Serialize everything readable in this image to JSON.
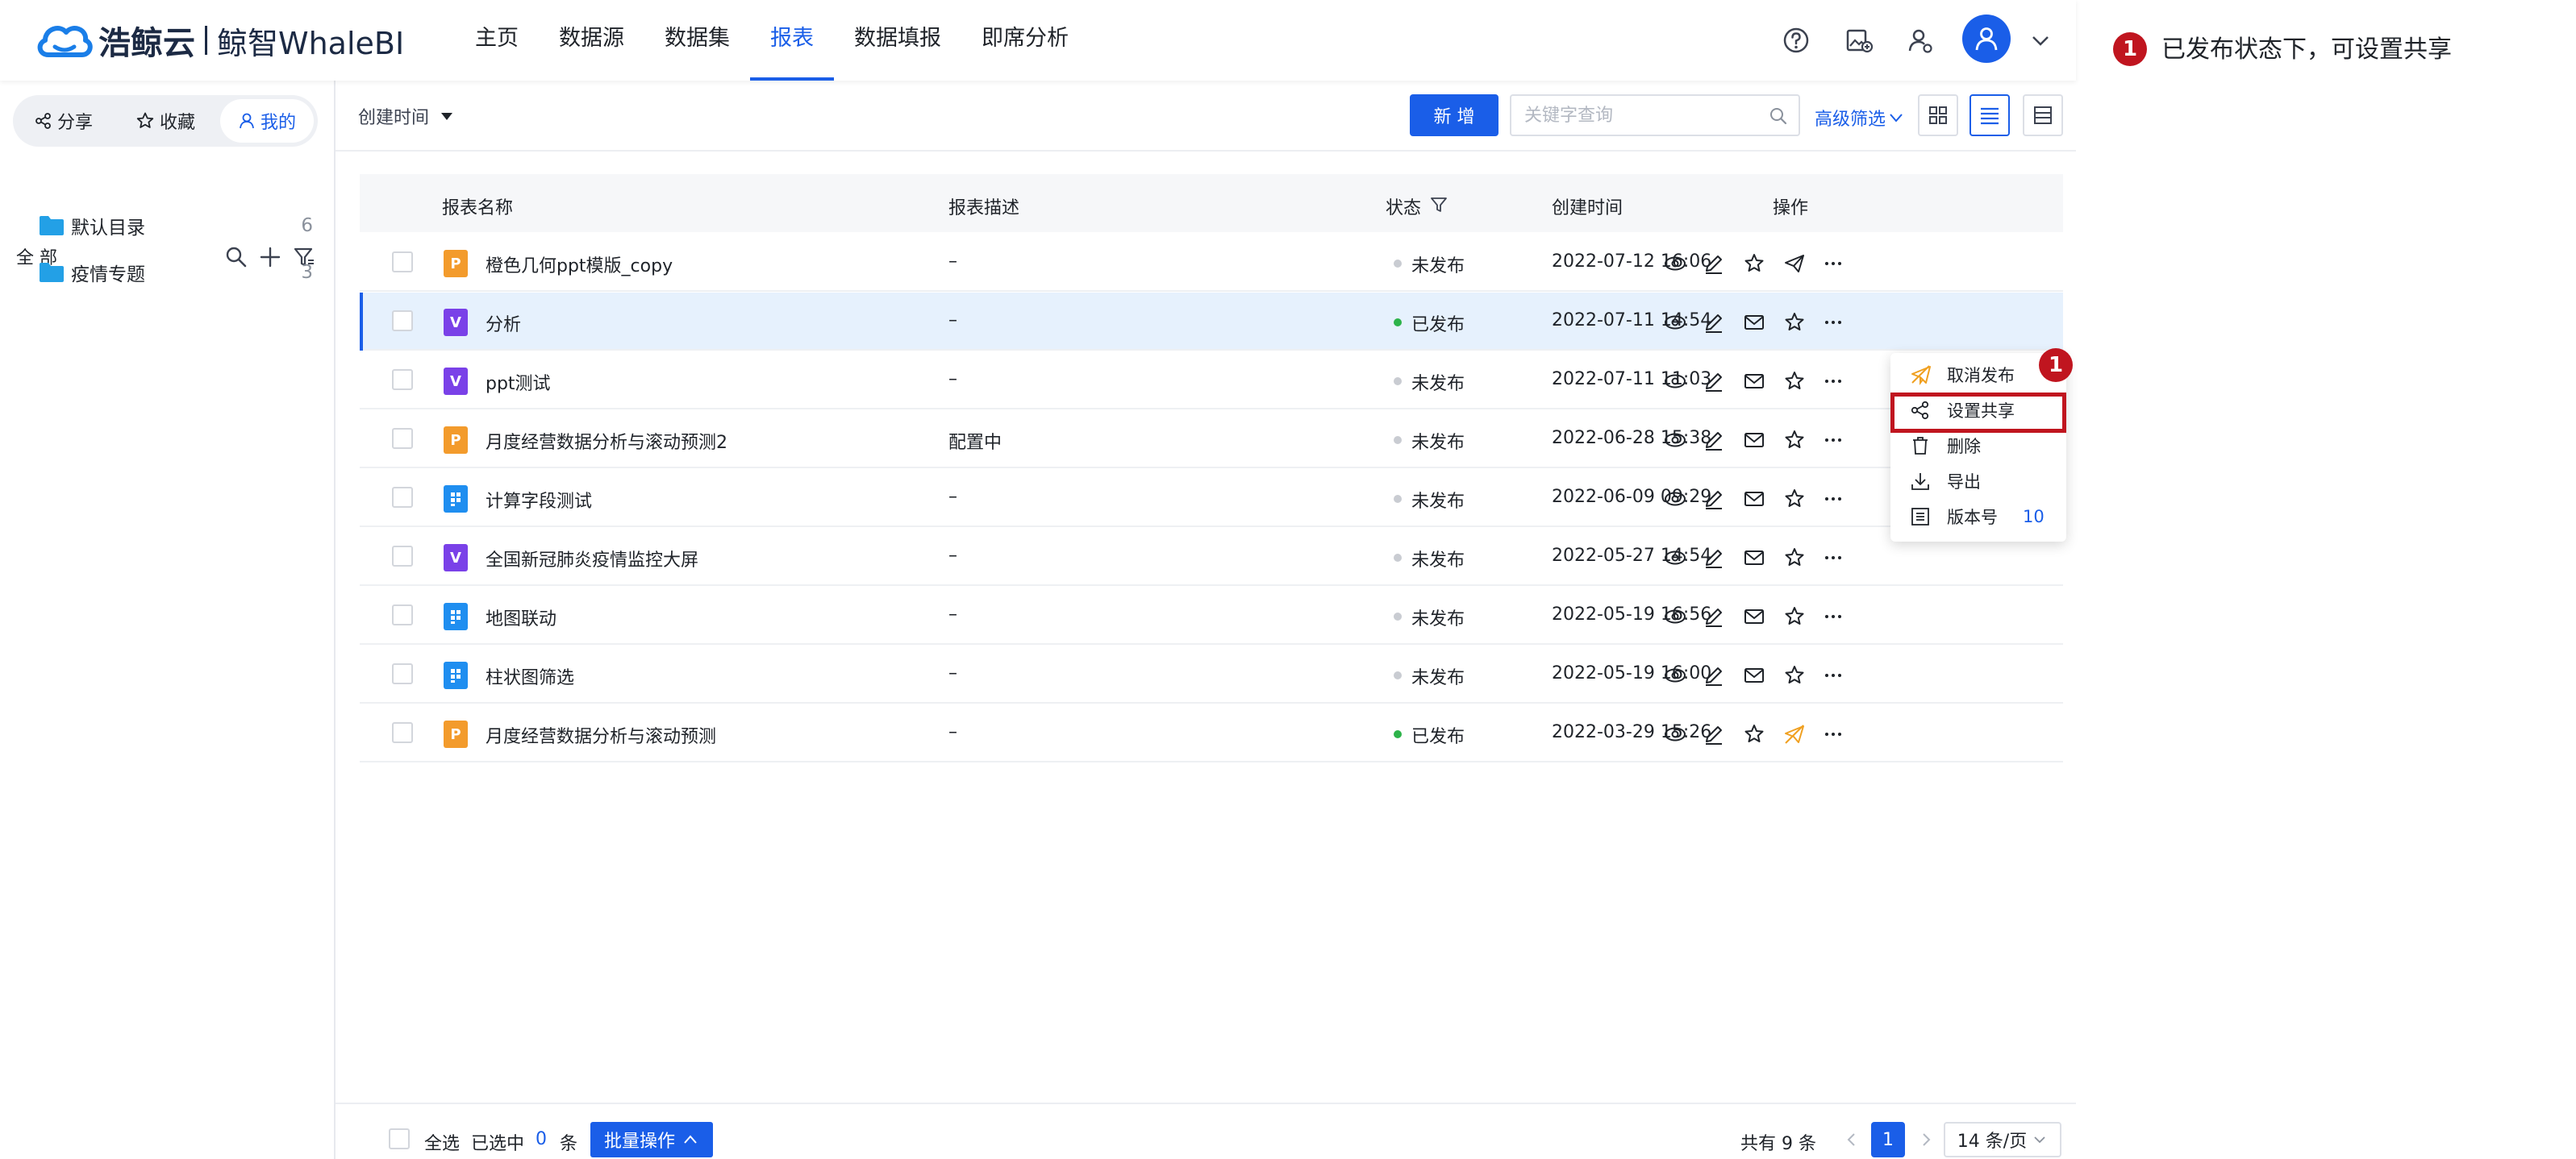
{
  "header": {
    "brand": "浩鲸云",
    "product": "鲸智WhaleBI",
    "nav": [
      "主页",
      "数据源",
      "数据集",
      "报表",
      "数据填报",
      "即席分析"
    ],
    "active_nav_index": 3,
    "icons": [
      "help-icon",
      "image-manage-icon",
      "user-manage-icon",
      "user-avatar-icon",
      "chevron-down-icon"
    ]
  },
  "sidebar": {
    "tabs": [
      "分享",
      "收藏",
      "我的"
    ],
    "active_tab_index": 2,
    "tree_root": "全 部",
    "folders": [
      {
        "name": "默认目录",
        "count": "6"
      },
      {
        "name": "疫情专题",
        "count": "3"
      }
    ]
  },
  "toolbar": {
    "sort_label": "创建时间",
    "add_label": "新 增",
    "search_placeholder": "关键字查询",
    "search_value": "",
    "advanced_filter": "高级筛选"
  },
  "table": {
    "columns": [
      "报表名称",
      "报表描述",
      "状态",
      "创建时间",
      "操作"
    ],
    "rows": [
      {
        "icon": "P",
        "name": "橙色几何ppt模版_copy",
        "desc": "–",
        "status": "未发布",
        "published": false,
        "time": "2022-07-12 16:06"
      },
      {
        "icon": "V",
        "name": "分析",
        "desc": "–",
        "status": "已发布",
        "published": true,
        "time": "2022-07-11 14:54",
        "selected": true
      },
      {
        "icon": "V",
        "name": "ppt测试",
        "desc": "–",
        "status": "未发布",
        "published": false,
        "time": "2022-07-11 11:03"
      },
      {
        "icon": "P",
        "name": "月度经营数据分析与滚动预测2",
        "desc": "配置中",
        "status": "未发布",
        "published": false,
        "time": "2022-06-28 15:38"
      },
      {
        "icon": "T",
        "name": "计算字段测试",
        "desc": "–",
        "status": "未发布",
        "published": false,
        "time": "2022-06-09 09:29"
      },
      {
        "icon": "V",
        "name": "全国新冠肺炎疫情监控大屏",
        "desc": "–",
        "status": "未发布",
        "published": false,
        "time": "2022-05-27 14:54"
      },
      {
        "icon": "T",
        "name": "地图联动",
        "desc": "–",
        "status": "未发布",
        "published": false,
        "time": "2022-05-19 16:56"
      },
      {
        "icon": "T",
        "name": "柱状图筛选",
        "desc": "–",
        "status": "未发布",
        "published": false,
        "time": "2022-05-19 16:00"
      },
      {
        "icon": "P",
        "name": "月度经营数据分析与滚动预测",
        "desc": "–",
        "status": "已发布",
        "published": true,
        "time": "2022-03-29 15:26"
      }
    ]
  },
  "menu": {
    "items": [
      "取消发布",
      "设置共享",
      "删除",
      "导出",
      "版本号"
    ],
    "version": "10",
    "highlighted_index": 1
  },
  "footer": {
    "select_all": "全选",
    "selected_prefix": "已选中",
    "selected_count": "0",
    "selected_unit": "条",
    "batch": "批量操作",
    "total": "共有 9 条",
    "current_page": "1",
    "per_page": "14 条/页"
  },
  "annotation": {
    "badge": "1",
    "text": "已发布状态下，可设置共享"
  },
  "colors": {
    "primary": "#1a5ee8",
    "published_dot": "#2db34a",
    "unpublished_dot": "#c9ccd2",
    "highlight": "#c0151f"
  }
}
